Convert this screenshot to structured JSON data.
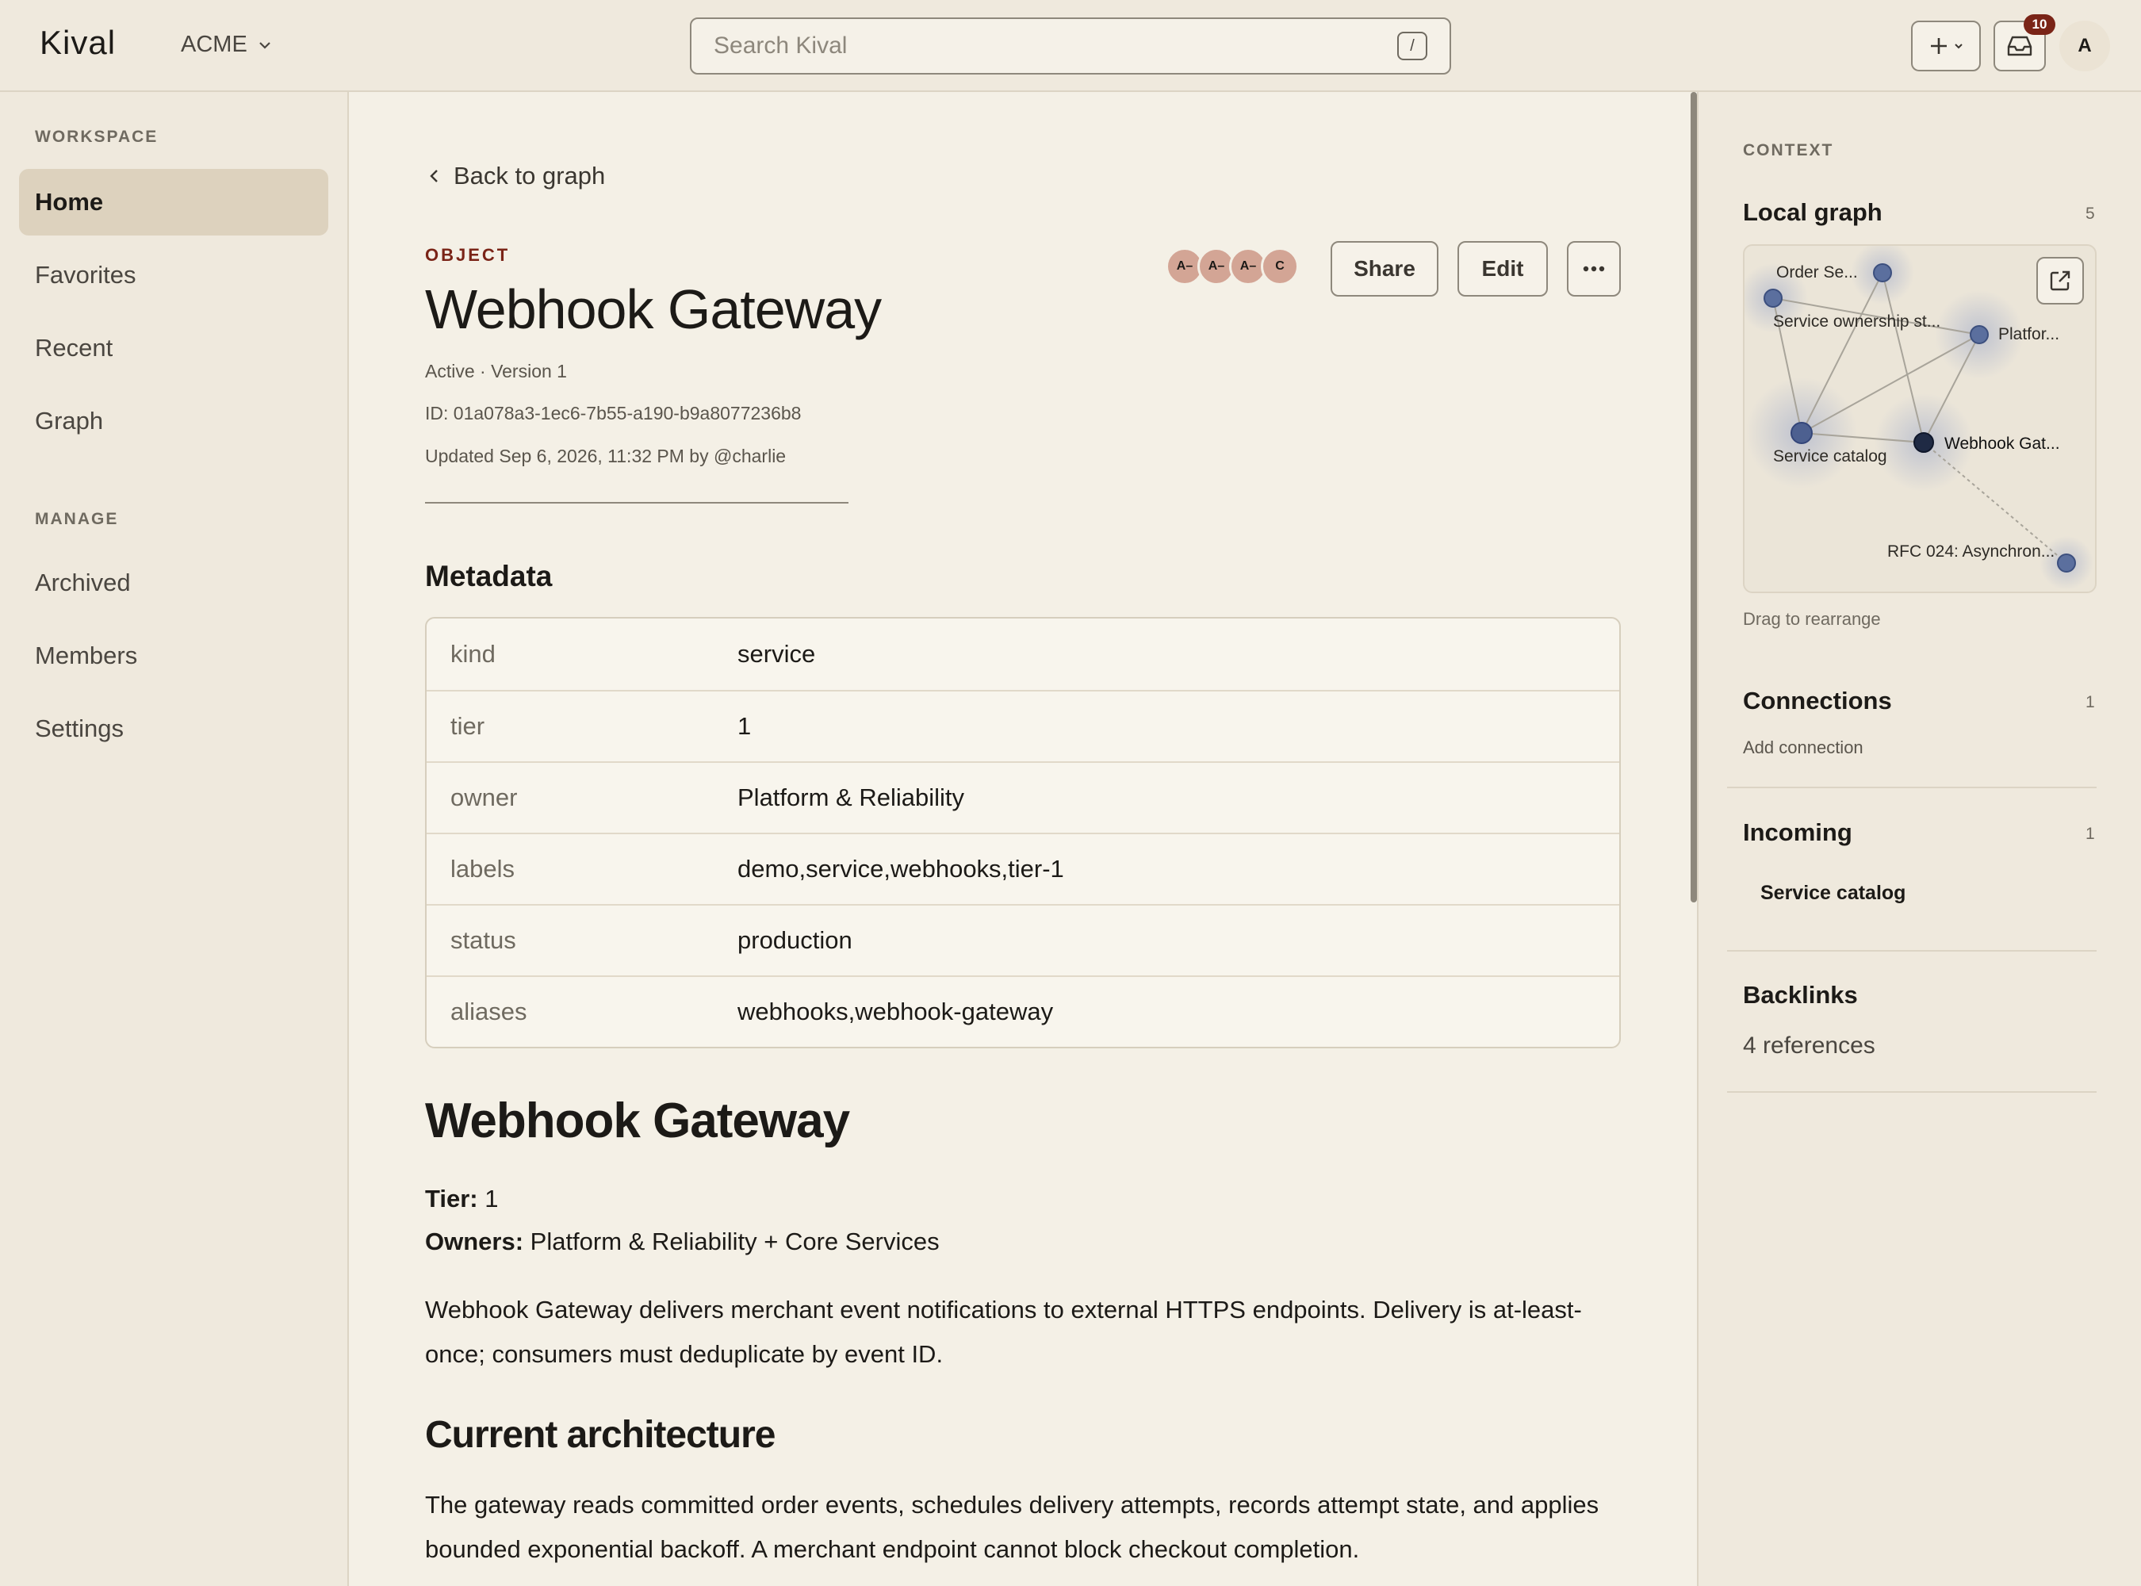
{
  "app": {
    "logo": "Kival",
    "org": "ACME",
    "search_placeholder": "Search Kival",
    "search_shortcut": "/",
    "inbox_badge": "10",
    "user_initial": "A"
  },
  "sidebar": {
    "workspace_heading": "WORKSPACE",
    "workspace_items": [
      {
        "label": "Home",
        "active": true
      },
      {
        "label": "Favorites"
      },
      {
        "label": "Recent"
      },
      {
        "label": "Graph"
      }
    ],
    "manage_heading": "MANAGE",
    "manage_items": [
      {
        "label": "Archived"
      },
      {
        "label": "Members"
      },
      {
        "label": "Settings"
      }
    ]
  },
  "object": {
    "back_label": "Back to graph",
    "type_label": "OBJECT",
    "title": "Webhook Gateway",
    "status_line": "Active · Version 1",
    "id_line": "ID: 01a078a3-1ec6-7b55-a190-b9a8077236b8",
    "updated_line": "Updated Sep 6, 2026, 11:32 PM by @charlie",
    "presence": [
      "A–",
      "A–",
      "A–",
      "C"
    ],
    "share_label": "Share",
    "edit_label": "Edit"
  },
  "metadata": {
    "heading": "Metadata",
    "rows": [
      {
        "key": "kind",
        "value": "service"
      },
      {
        "key": "tier",
        "value": "1"
      },
      {
        "key": "owner",
        "value": "Platform & Reliability"
      },
      {
        "key": "labels",
        "value": "demo,service,webhooks,tier-1"
      },
      {
        "key": "status",
        "value": "production"
      },
      {
        "key": "aliases",
        "value": "webhooks,webhook-gateway"
      }
    ]
  },
  "document": {
    "h1": "Webhook Gateway",
    "tier_label": "Tier:",
    "tier_value": " 1",
    "owners_label": "Owners:",
    "owners_value": " Platform & Reliability + Core Services",
    "para1": "Webhook Gateway delivers merchant event notifications to external HTTPS endpoints. Delivery is at-least-once; consumers must deduplicate by event ID.",
    "h2": "Current architecture",
    "para2": "The gateway reads committed order events, schedules delivery attempts, records attempt state, and applies bounded exponential backoff. A merchant endpoint cannot block checkout completion."
  },
  "context": {
    "heading": "CONTEXT",
    "local_graph": {
      "title": "Local graph",
      "count": "5",
      "hint": "Drag to rearrange",
      "nodes": [
        {
          "label": "Order Se...",
          "focus": false
        },
        {
          "label": "Service ownership st...",
          "focus": false
        },
        {
          "label": "Platfor...",
          "focus": false
        },
        {
          "label": "Service catalog",
          "focus": false
        },
        {
          "label": "Webhook Gat...",
          "focus": true
        },
        {
          "label": "RFC 024: Asynchron...",
          "focus": false
        }
      ]
    },
    "connections": {
      "title": "Connections",
      "count": "1",
      "action": "Add connection"
    },
    "incoming": {
      "title": "Incoming",
      "count": "1",
      "items": [
        "Service catalog"
      ]
    },
    "backlinks": {
      "title": "Backlinks",
      "summary": "4 references"
    }
  }
}
